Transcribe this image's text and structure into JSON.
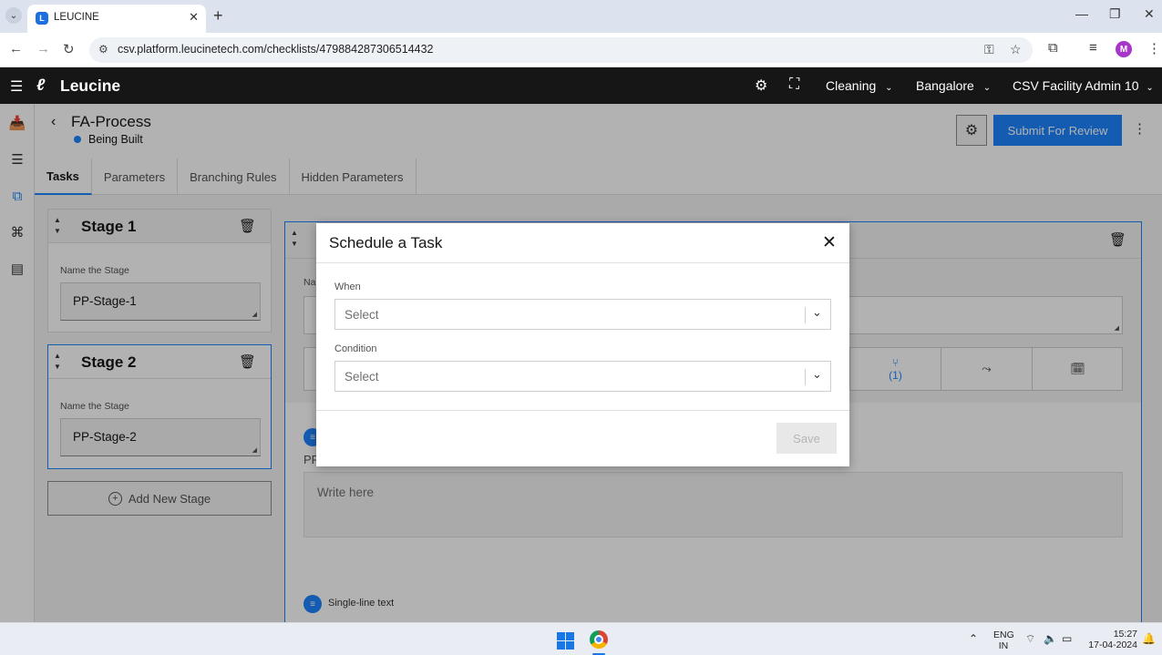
{
  "browser": {
    "tab_title": "LEUCINE",
    "url": "csv.platform.leucinetech.com/checklists/479884287306514432",
    "profile_initial": "M"
  },
  "app": {
    "brand": "Leucine",
    "header_items": [
      {
        "label": "Cleaning",
        "name": "facility-process-dropdown"
      },
      {
        "label": "Bangalore",
        "name": "site-dropdown"
      },
      {
        "label": "CSV Facility Admin 10",
        "name": "user-dropdown"
      }
    ]
  },
  "process": {
    "title": "FA-Process",
    "status": "Being Built",
    "status_color": "#1d84ff",
    "submit_label": "Submit For Review"
  },
  "tabs": [
    {
      "label": "Tasks",
      "active": true
    },
    {
      "label": "Parameters",
      "active": false
    },
    {
      "label": "Branching Rules",
      "active": false
    },
    {
      "label": "Hidden Parameters",
      "active": false
    }
  ],
  "stages": [
    {
      "title": "Stage 1",
      "field_label": "Name the Stage",
      "value": "PP-Stage-1"
    },
    {
      "title": "Stage 2",
      "field_label": "Name the Stage",
      "value": "PP-Stage-2"
    }
  ],
  "add_stage_label": "Add New Stage",
  "task_panel": {
    "name_label": "Na",
    "branch_count": "(1)",
    "param_label": "PP",
    "write_placeholder": "Write here",
    "single_line_label": "Single-line text"
  },
  "modal": {
    "title": "Schedule a Task",
    "when_label": "When",
    "when_placeholder": "Select",
    "condition_label": "Condition",
    "condition_placeholder": "Select",
    "save_label": "Save"
  },
  "taskbar": {
    "lang_top": "ENG",
    "lang_bottom": "IN",
    "time": "15:27",
    "date": "17-04-2024"
  },
  "colors": {
    "accent": "#1d84ff",
    "header_bg": "#161616"
  }
}
